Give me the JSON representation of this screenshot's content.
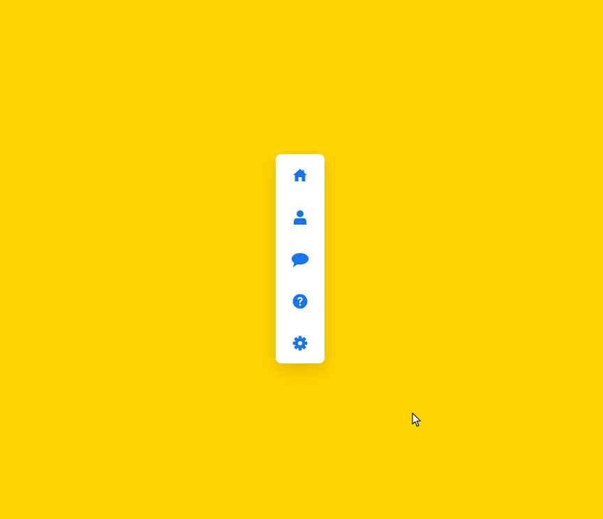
{
  "colors": {
    "background": "#ffd400",
    "panel": "#ffffff",
    "accent": "#1a73e8"
  },
  "nav": {
    "items": [
      {
        "icon": "home-icon"
      },
      {
        "icon": "user-icon"
      },
      {
        "icon": "chat-icon"
      },
      {
        "icon": "help-icon"
      },
      {
        "icon": "gear-icon"
      }
    ]
  }
}
